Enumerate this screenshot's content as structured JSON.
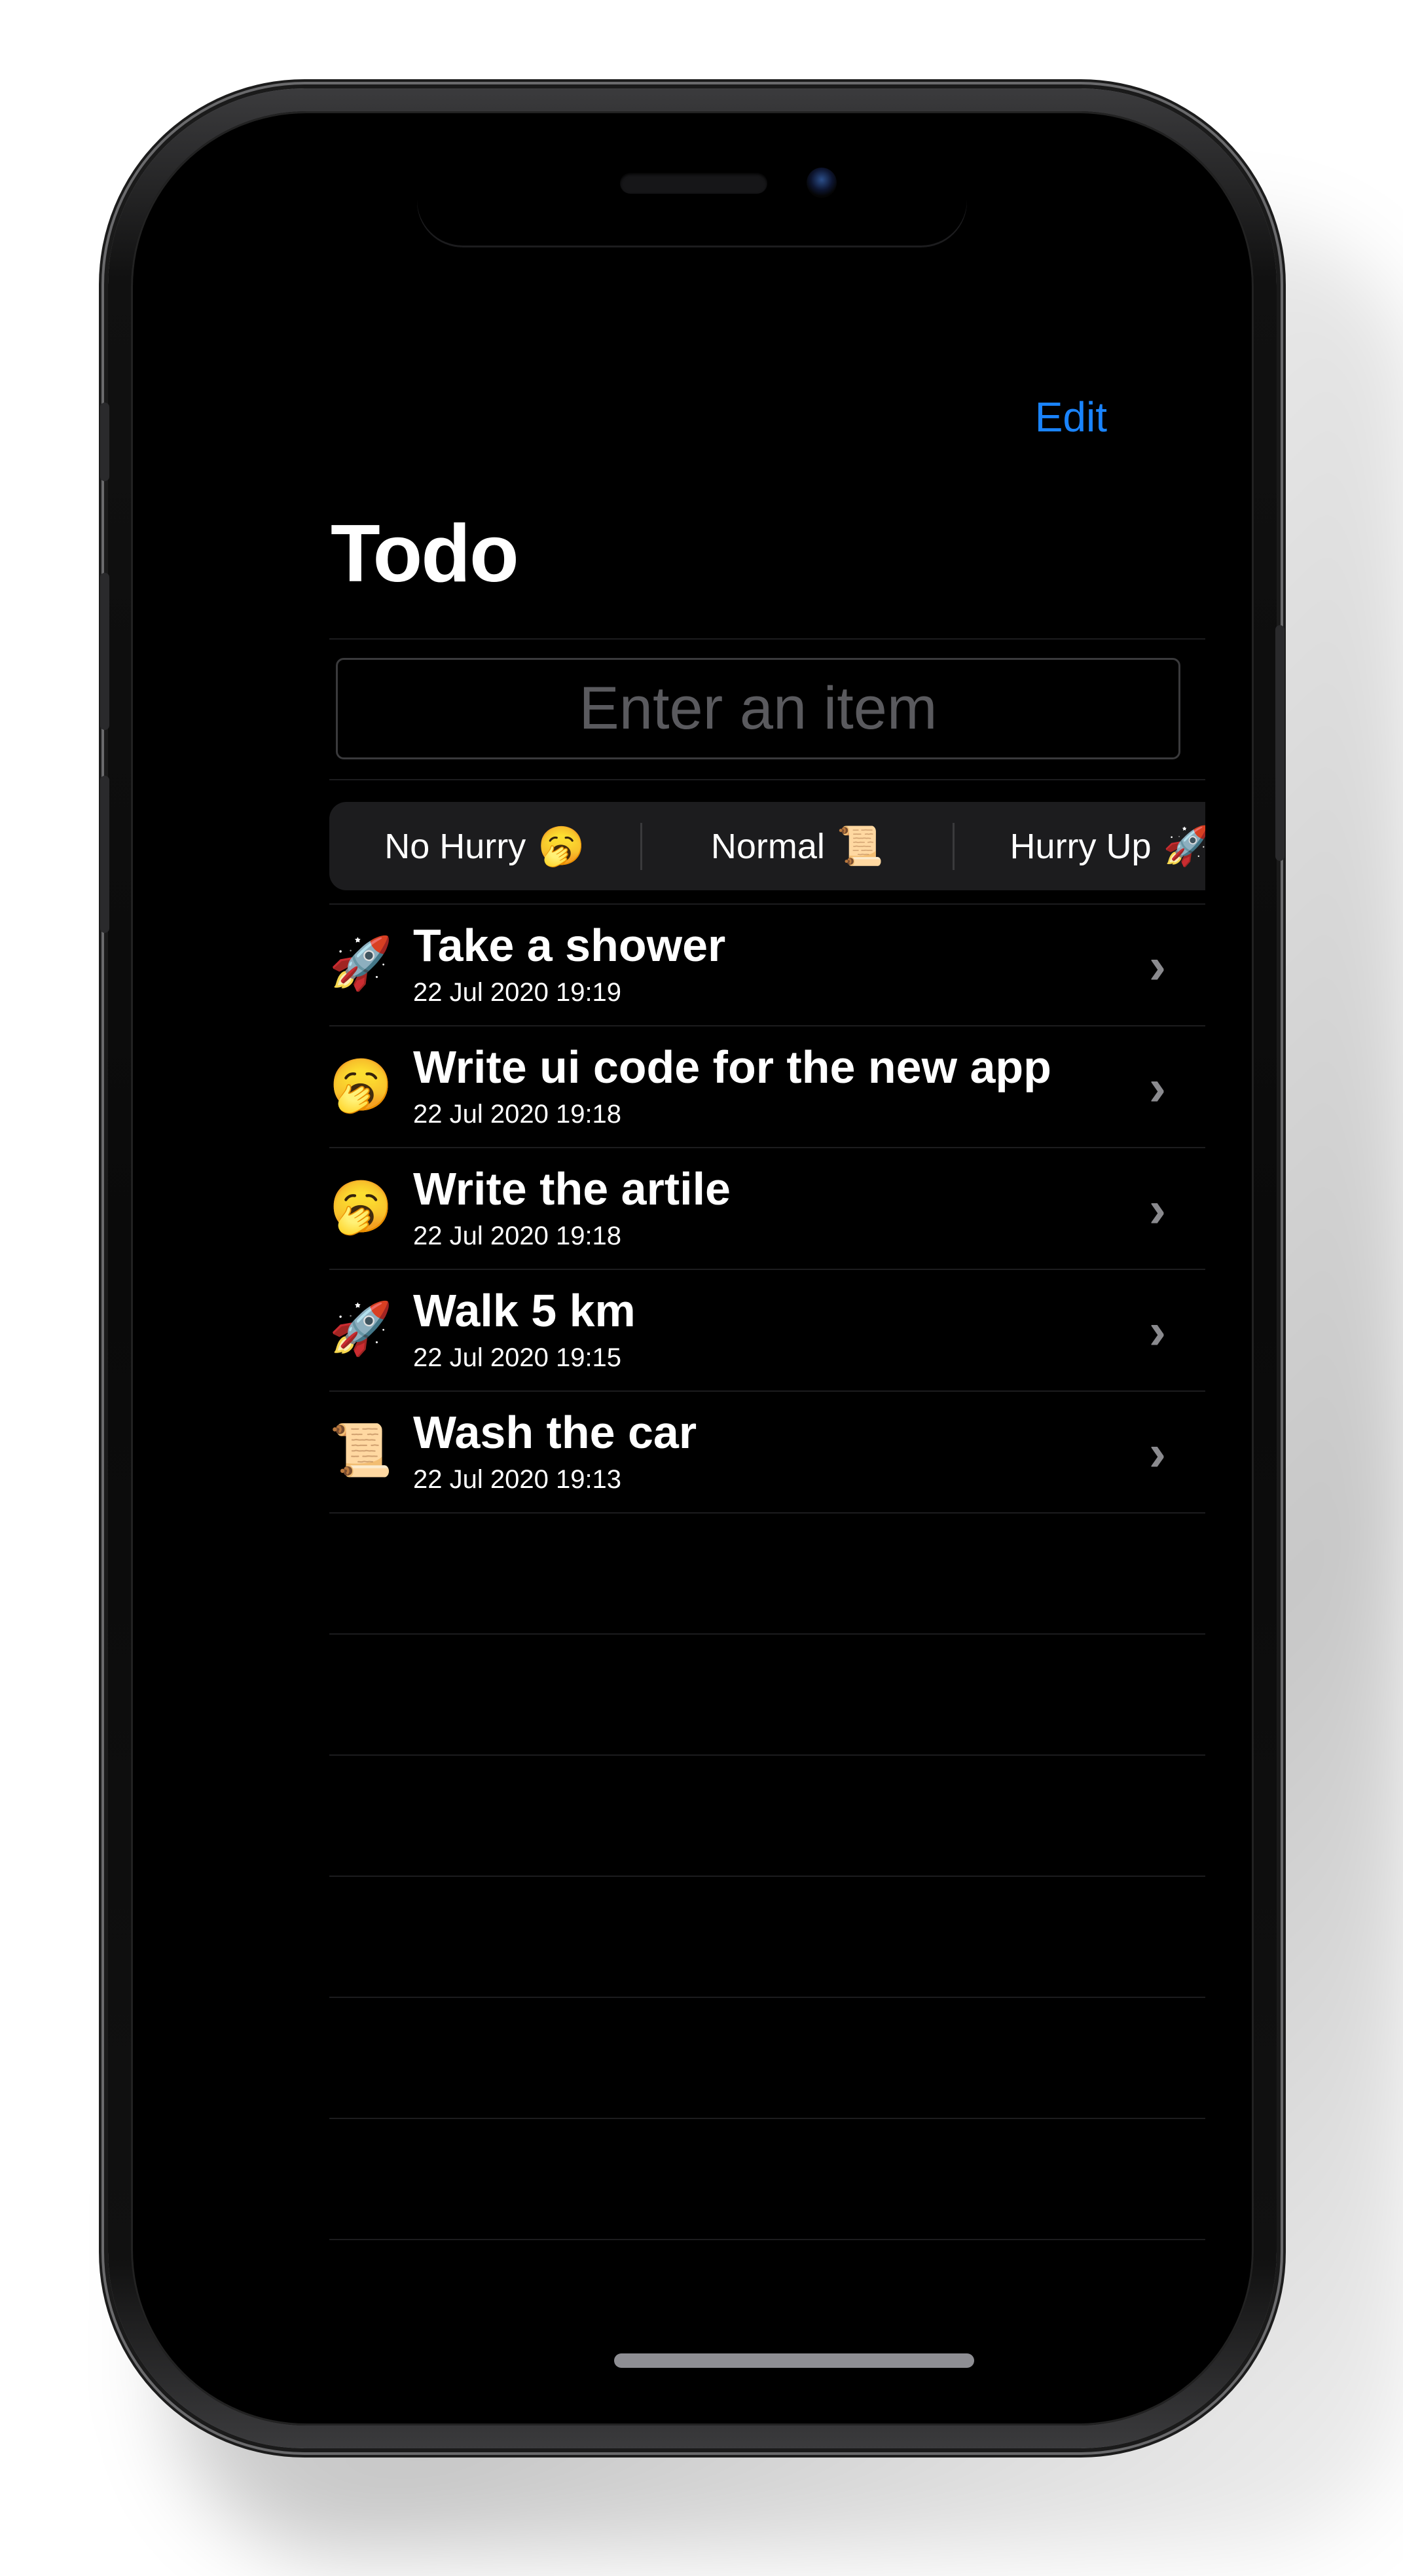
{
  "nav": {
    "edit_label": "Edit",
    "title": "Todo"
  },
  "new_item": {
    "placeholder": "Enter an item",
    "add_icon_glyph": "+"
  },
  "priority_segments": [
    {
      "label": "No Hurry",
      "emoji": "🥱"
    },
    {
      "label": "Normal",
      "emoji": "📜"
    },
    {
      "label": "Hurry Up",
      "emoji": "🚀"
    }
  ],
  "items": [
    {
      "emoji": "🚀",
      "title": "Take a shower",
      "date": "22 Jul 2020 19:19"
    },
    {
      "emoji": "🥱",
      "title": "Write ui code for the new app",
      "date": "22 Jul 2020 19:18"
    },
    {
      "emoji": "🥱",
      "title": "Write the artile",
      "date": "22 Jul 2020 19:18"
    },
    {
      "emoji": "🚀",
      "title": "Walk 5 km",
      "date": "22 Jul 2020 19:15"
    },
    {
      "emoji": "📜",
      "title": "Wash the car",
      "date": "22 Jul 2020 19:13"
    }
  ],
  "chevron_glyph": "›",
  "colors": {
    "accent": "#1a84ff",
    "background": "#000000",
    "separator": "#1c1c1e"
  }
}
